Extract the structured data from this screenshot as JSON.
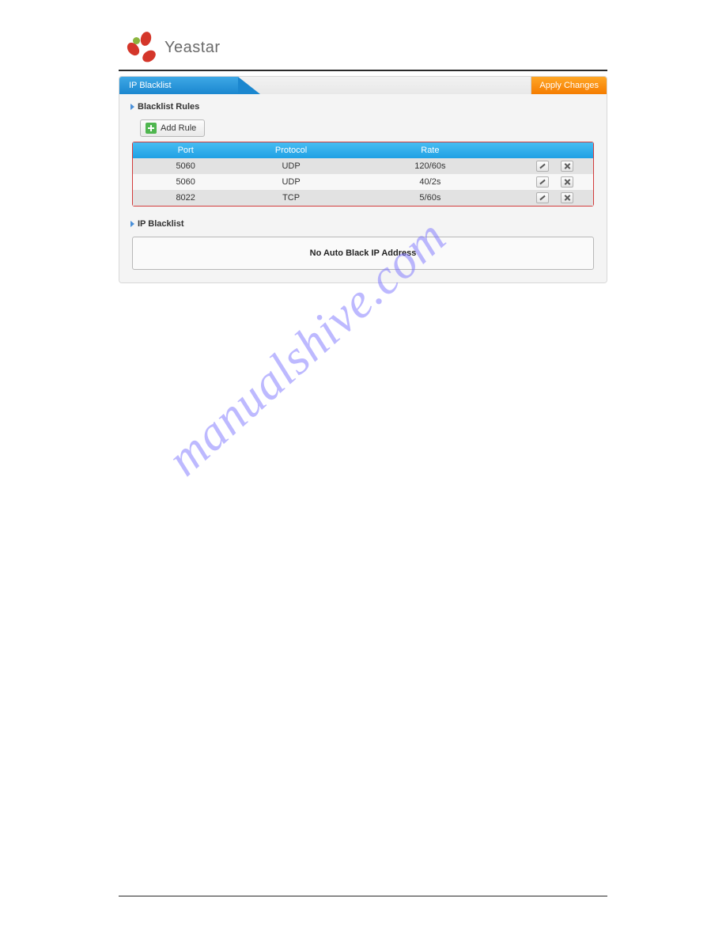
{
  "brand": {
    "name": "Yeastar"
  },
  "header": {
    "title": "IP Blacklist",
    "apply_label": "Apply Changes"
  },
  "sections": {
    "rules_heading": "Blacklist Rules",
    "add_rule_label": "Add Rule",
    "ip_heading": "IP Blacklist",
    "no_ip_text": "No Auto Black IP Address"
  },
  "rules_table": {
    "headers": {
      "port": "Port",
      "protocol": "Protocol",
      "rate": "Rate"
    },
    "rows": [
      {
        "port": "5060",
        "protocol": "UDP",
        "rate": "120/60s"
      },
      {
        "port": "5060",
        "protocol": "UDP",
        "rate": "40/2s"
      },
      {
        "port": "8022",
        "protocol": "TCP",
        "rate": "5/60s"
      }
    ]
  },
  "watermark": "manualshive.com"
}
